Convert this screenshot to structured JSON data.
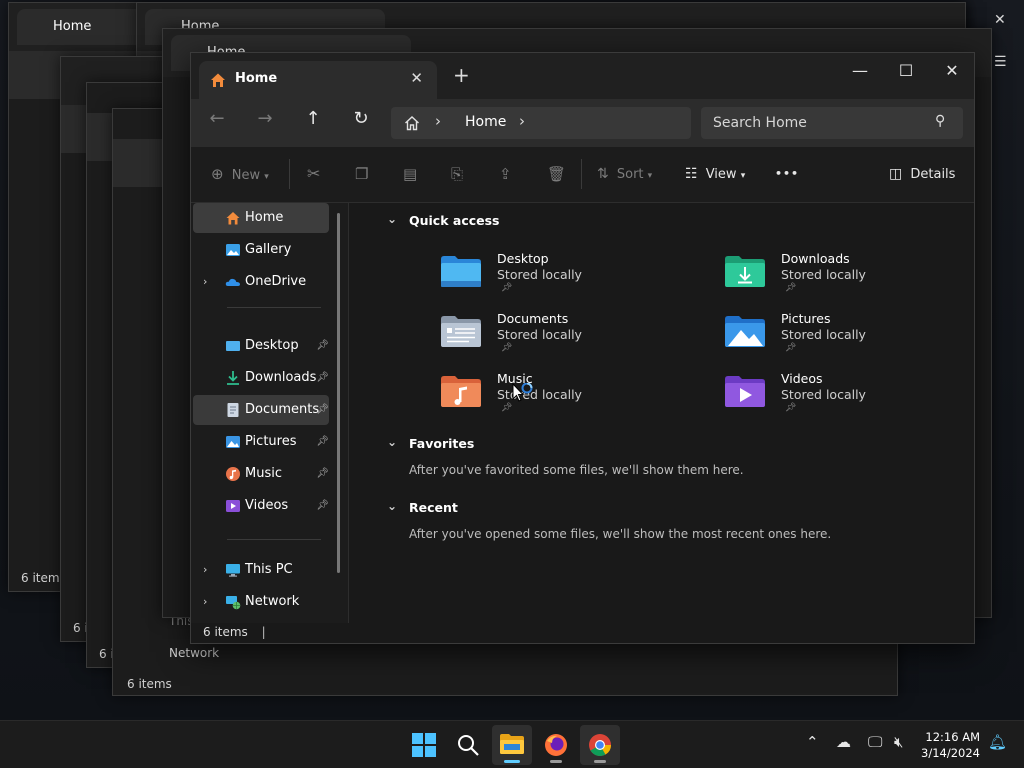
{
  "window": {
    "tab_title": "Home",
    "close_tab": "✕",
    "new_tab": "+",
    "minimize": "—",
    "maximize": "☐",
    "close": "✕"
  },
  "nav": {
    "back": "←",
    "forward": "→",
    "up": "↑",
    "refresh": "↻",
    "breadcrumb": "Home",
    "search_placeholder": "Search Home"
  },
  "toolbar": {
    "new_label": "New",
    "sort_label": "Sort",
    "view_label": "View",
    "more_label": "•••",
    "details_label": "Details"
  },
  "sidebar": {
    "items": [
      {
        "label": "Home",
        "icon": "home-icon"
      },
      {
        "label": "Gallery",
        "icon": "gallery-icon"
      },
      {
        "label": "OneDrive",
        "icon": "cloud-icon"
      },
      {
        "label": "Desktop",
        "icon": "desktop-folder-icon"
      },
      {
        "label": "Downloads",
        "icon": "download-icon"
      },
      {
        "label": "Documents",
        "icon": "documents-icon"
      },
      {
        "label": "Pictures",
        "icon": "pictures-icon"
      },
      {
        "label": "Music",
        "icon": "music-icon"
      },
      {
        "label": "Videos",
        "icon": "videos-icon"
      },
      {
        "label": "This PC",
        "icon": "computer-icon"
      },
      {
        "label": "Network",
        "icon": "network-icon"
      }
    ]
  },
  "content": {
    "quick_access_title": "Quick access",
    "quick_access": [
      {
        "name": "Desktop",
        "sub": "Stored locally"
      },
      {
        "name": "Downloads",
        "sub": "Stored locally"
      },
      {
        "name": "Documents",
        "sub": "Stored locally"
      },
      {
        "name": "Pictures",
        "sub": "Stored locally"
      },
      {
        "name": "Music",
        "sub": "Stored locally"
      },
      {
        "name": "Videos",
        "sub": "Stored locally"
      }
    ],
    "favorites_title": "Favorites",
    "favorites_msg": "After you've favorited some files, we'll show them here.",
    "recent_title": "Recent",
    "recent_msg": "After you've opened some files, we'll show the most recent ones here."
  },
  "status": {
    "items": "6 items",
    "bg_items": "6 items",
    "bg_this_pc": "This PC",
    "bg_network": "Network",
    "bg_tab": "Home"
  },
  "taskbar": {
    "time": "12:16 AM",
    "date": "3/14/2024"
  },
  "colors": {
    "accent": "#60cdff",
    "home_icon": "#f28b3c",
    "folder_blue": "#3aa0e8",
    "folder_green": "#2ebd8e"
  }
}
